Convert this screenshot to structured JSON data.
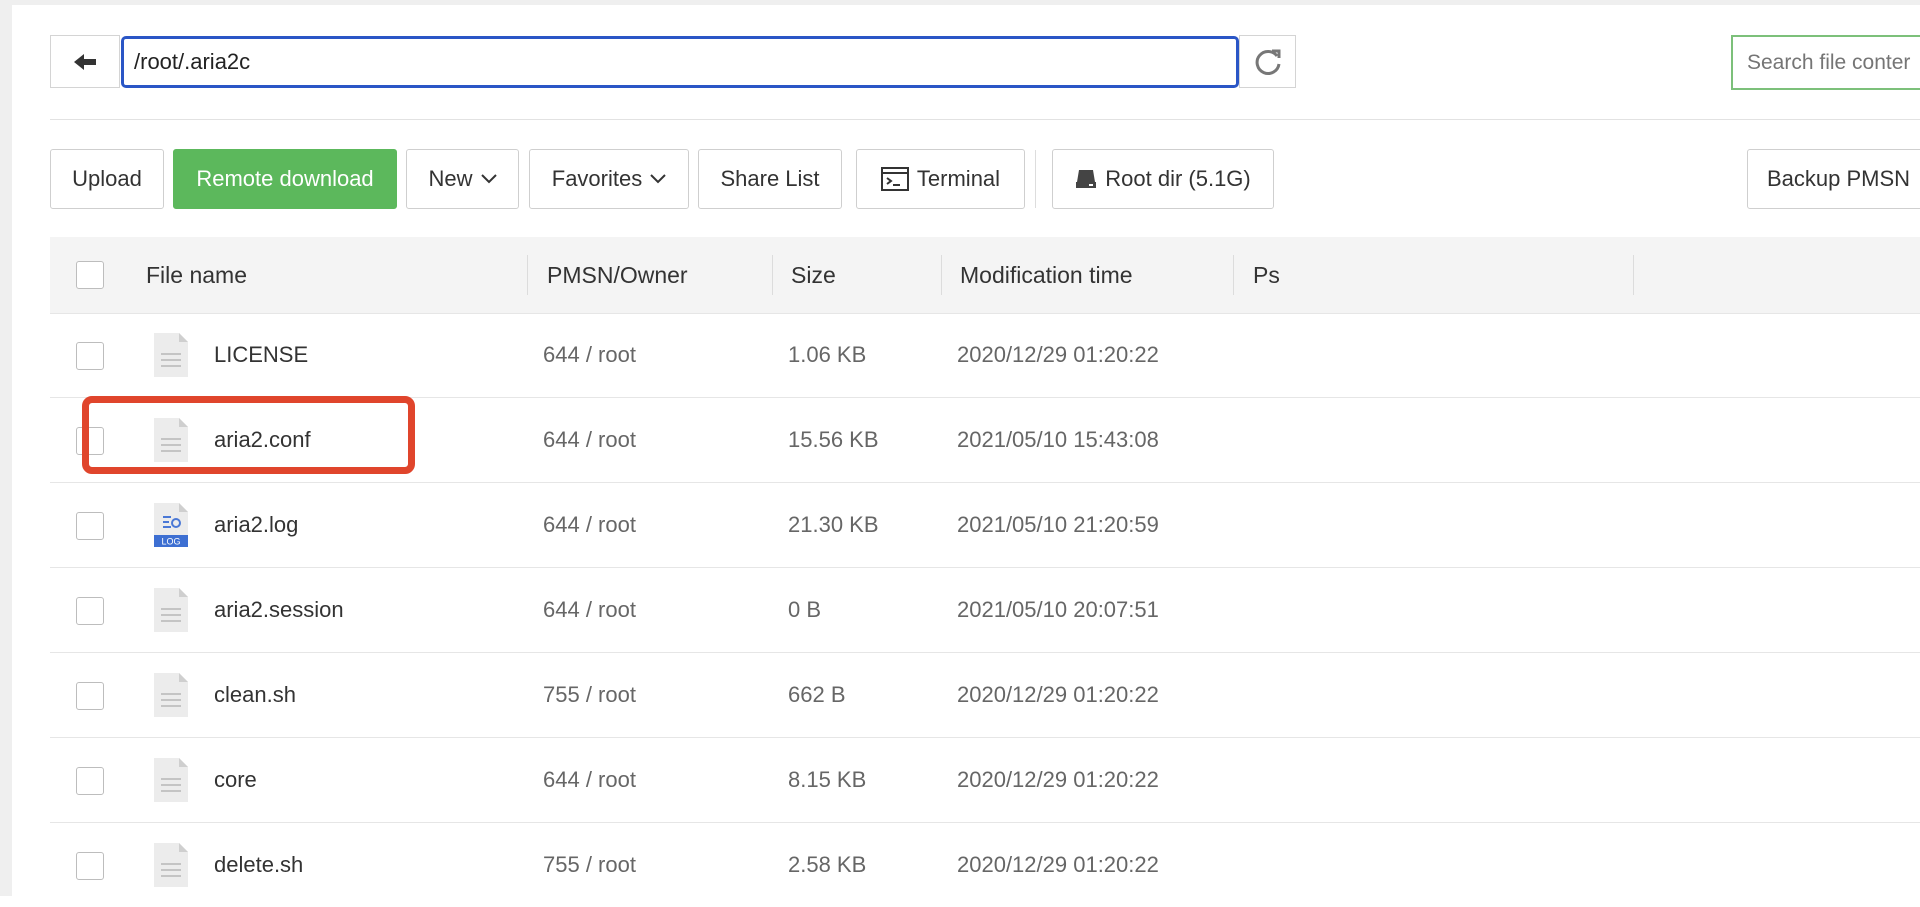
{
  "address_bar": {
    "path": "/root/.aria2c",
    "search_placeholder": "Search file conter"
  },
  "toolbar": {
    "upload": "Upload",
    "remote_download": "Remote download",
    "new": "New",
    "favorites": "Favorites",
    "share_list": "Share List",
    "terminal": "Terminal",
    "root_dir": "Root dir (5.1G)",
    "backup": "Backup PMSN",
    "accent_color": "#5cb85c"
  },
  "table": {
    "headers": {
      "name": "File name",
      "owner": "PMSN/Owner",
      "size": "Size",
      "mtime": "Modification time",
      "ps": "Ps"
    },
    "rows": [
      {
        "name": "LICENSE",
        "owner": "644 / root",
        "size": "1.06 KB",
        "mtime": "2020/12/29 01:20:22",
        "icon": "text-file-icon"
      },
      {
        "name": "aria2.conf",
        "owner": "644 / root",
        "size": "15.56 KB",
        "mtime": "2021/05/10 15:43:08",
        "icon": "text-file-icon"
      },
      {
        "name": "aria2.log",
        "owner": "644 / root",
        "size": "21.30 KB",
        "mtime": "2021/05/10 21:20:59",
        "icon": "log-file-icon",
        "icon_label": "LOG"
      },
      {
        "name": "aria2.session",
        "owner": "644 / root",
        "size": "0 B",
        "mtime": "2021/05/10 20:07:51",
        "icon": "text-file-icon"
      },
      {
        "name": "clean.sh",
        "owner": "755 / root",
        "size": "662 B",
        "mtime": "2020/12/29 01:20:22",
        "icon": "text-file-icon"
      },
      {
        "name": "core",
        "owner": "644 / root",
        "size": "8.15 KB",
        "mtime": "2020/12/29 01:20:22",
        "icon": "text-file-icon"
      },
      {
        "name": "delete.sh",
        "owner": "755 / root",
        "size": "2.58 KB",
        "mtime": "2020/12/29 01:20:22",
        "icon": "text-file-icon"
      }
    ]
  },
  "highlight_color": "#e0452c"
}
